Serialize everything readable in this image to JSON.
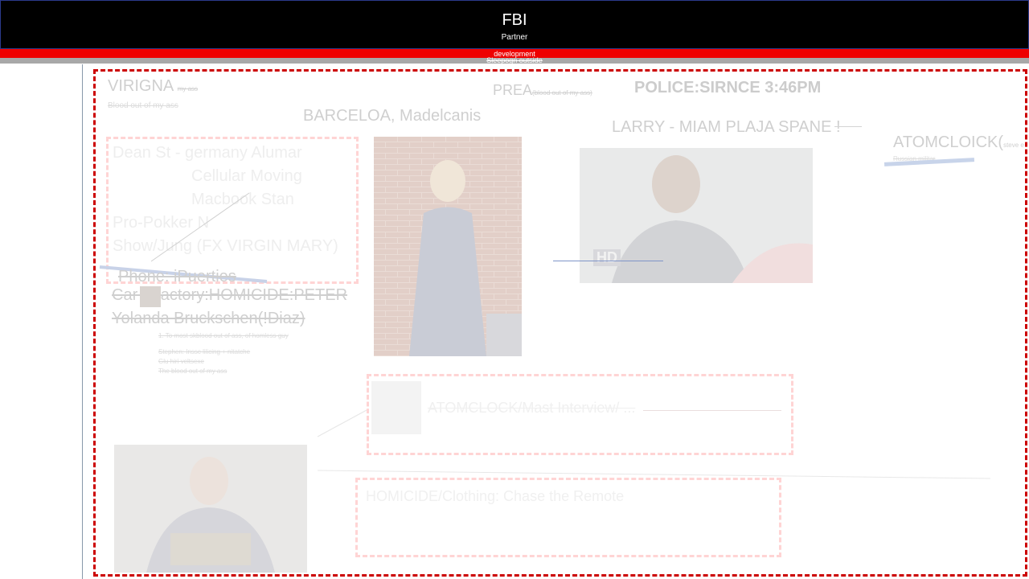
{
  "header": {
    "title": "FBI",
    "subtitle": "Partner",
    "bar_red_text": "development",
    "bar_gray_text": "Sleepogn outside"
  },
  "board": {
    "virigna": {
      "label": "VIRIGNA",
      "note": "my ass",
      "sub": "Blood out of my ass"
    },
    "prea": {
      "label": "PREA",
      "note": "(blood out of my ass)"
    },
    "police": "POLICE:SIRNCE 3:46PM",
    "barcelona": "BARCELOA, Madelcanis",
    "larry": "LARRY - MIAM PLAJA SPANE   !",
    "atomclock": {
      "label": "ATOMCLOICK(",
      "note": "steve e",
      "sub": "Russian militar"
    },
    "left_box_lines": [
      "Dean St - germany Alumar",
      "Cellular Moving",
      "Macbook Stan",
      "Pro-Pokker N",
      "Show/Jung (FX VIRGIN MARY)"
    ],
    "phone": "Phone: iPuerties",
    "factory": "Car   | Factory:HOMICIDE:PETER",
    "yolanda": "Yolanda Bruckschen(!Diaz)",
    "notes": [
      "1.        To most skblood out of ass, of homless guy",
      "Stephen: Inssc lilicing + nitatche",
      "Glu hiri veltsexe",
      "The blood out of my ass"
    ],
    "hd_badge": "HD",
    "middle_box_text": "ATOMCLOCK/Mast Interview/ ...",
    "bottom_box_text": "HOMICIDE/Clothing: Chase the Remote"
  },
  "colors": {
    "header_bg": "#000000",
    "red_bar": "#ee0000",
    "gray_bar": "#a8a8a8",
    "board_border": "#cc0000",
    "faint_text": "#cfcfcf"
  }
}
